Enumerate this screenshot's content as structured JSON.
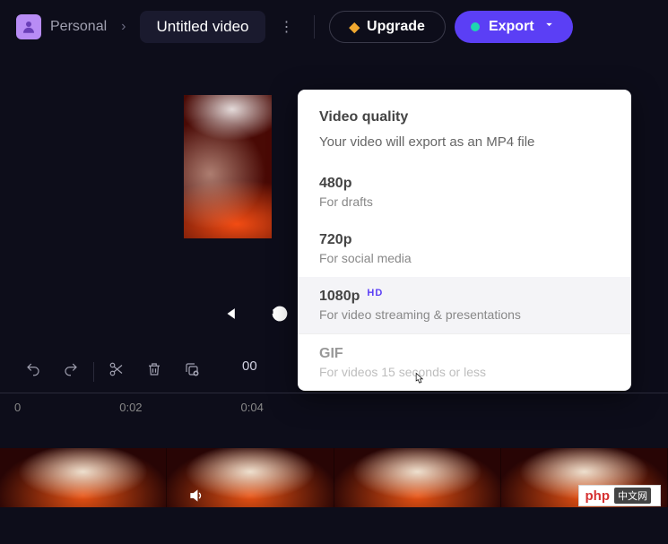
{
  "header": {
    "workspace": "Personal",
    "title": "Untitled video",
    "upgrade": "Upgrade",
    "export": "Export"
  },
  "dropdown": {
    "title": "Video quality",
    "subtitle": "Your video will export as an MP4 file",
    "options": [
      {
        "label": "480p",
        "desc": "For drafts",
        "badge": ""
      },
      {
        "label": "720p",
        "desc": "For social media",
        "badge": ""
      },
      {
        "label": "1080p",
        "desc": "For video streaming & presentations",
        "badge": "HD"
      },
      {
        "label": "GIF",
        "desc": "For videos 15 seconds or less",
        "badge": ""
      }
    ],
    "hovered_index": 2,
    "disabled_index": 3
  },
  "timeline": {
    "current_time": "00",
    "ticks": [
      "0",
      "0:02",
      "0:04"
    ]
  },
  "badge": {
    "text": "php",
    "cn": "中文网"
  }
}
